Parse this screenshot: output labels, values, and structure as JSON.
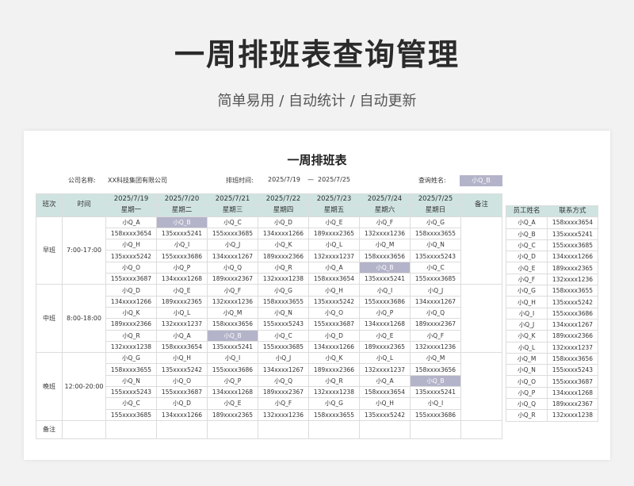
{
  "hero": {
    "title": "一周排班表查询管理",
    "subtitle": "简单易用  /  自动统计  /  自动更新"
  },
  "sheet": {
    "title": "一周排班表",
    "company_label": "公司名称:",
    "company_value": "XX科技集团有限公司",
    "period_label": "排班时间:",
    "period_start": "2025/7/19",
    "period_sep": "—",
    "period_end": "2025/7/25",
    "query_label": "查询姓名:",
    "query_value": "小Q_B"
  },
  "schedule": {
    "col_shift": "班次",
    "col_time": "时间",
    "col_remark": "备注",
    "days": [
      {
        "date": "2025/7/19",
        "weekday": "星期一"
      },
      {
        "date": "2025/7/20",
        "weekday": "星期二"
      },
      {
        "date": "2025/7/21",
        "weekday": "星期三"
      },
      {
        "date": "2025/7/22",
        "weekday": "星期四"
      },
      {
        "date": "2025/7/23",
        "weekday": "星期五"
      },
      {
        "date": "2025/7/24",
        "weekday": "星期六"
      },
      {
        "date": "2025/7/25",
        "weekday": "星期日"
      }
    ],
    "shifts": [
      {
        "name": "早班",
        "time": "7:00-17:00",
        "rows": [
          [
            [
              "小Q_A",
              "158xxxx3654"
            ],
            [
              "小Q_B",
              "135xxxx5241"
            ],
            [
              "小Q_C",
              "155xxxx3685"
            ],
            [
              "小Q_D",
              "134xxxx1266"
            ],
            [
              "小Q_E",
              "189xxxx2365"
            ],
            [
              "小Q_F",
              "132xxxx1236"
            ],
            [
              "小Q_G",
              "158xxxx3655"
            ]
          ],
          [
            [
              "小Q_H",
              "135xxxx5242"
            ],
            [
              "小Q_I",
              "155xxxx3686"
            ],
            [
              "小Q_J",
              "134xxxx1267"
            ],
            [
              "小Q_K",
              "189xxxx2366"
            ],
            [
              "小Q_L",
              "132xxxx1237"
            ],
            [
              "小Q_M",
              "158xxxx3656"
            ],
            [
              "小Q_N",
              "135xxxx5243"
            ]
          ],
          [
            [
              "小Q_O",
              "155xxxx3687"
            ],
            [
              "小Q_P",
              "134xxxx1268"
            ],
            [
              "小Q_Q",
              "189xxxx2367"
            ],
            [
              "小Q_R",
              "132xxxx1238"
            ],
            [
              "小Q_A",
              "158xxxx3654"
            ],
            [
              "小Q_B",
              "135xxxx5241"
            ],
            [
              "小Q_C",
              "155xxxx3685"
            ]
          ]
        ]
      },
      {
        "name": "中班",
        "time": "8:00-18:00",
        "rows": [
          [
            [
              "小Q_D",
              "134xxxx1266"
            ],
            [
              "小Q_E",
              "189xxxx2365"
            ],
            [
              "小Q_F",
              "132xxxx1236"
            ],
            [
              "小Q_G",
              "158xxxx3655"
            ],
            [
              "小Q_H",
              "135xxxx5242"
            ],
            [
              "小Q_I",
              "155xxxx3686"
            ],
            [
              "小Q_J",
              "134xxxx1267"
            ]
          ],
          [
            [
              "小Q_K",
              "189xxxx2366"
            ],
            [
              "小Q_L",
              "132xxxx1237"
            ],
            [
              "小Q_M",
              "158xxxx3656"
            ],
            [
              "小Q_N",
              "155xxxx5243"
            ],
            [
              "小Q_O",
              "155xxxx3687"
            ],
            [
              "小Q_P",
              "134xxxx1268"
            ],
            [
              "小Q_Q",
              "189xxxx2367"
            ]
          ],
          [
            [
              "小Q_R",
              "132xxxx1238"
            ],
            [
              "小Q_A",
              "158xxxx3654"
            ],
            [
              "小Q_B",
              "135xxxx5241"
            ],
            [
              "小Q_C",
              "155xxxx3685"
            ],
            [
              "小Q_D",
              "134xxxx1266"
            ],
            [
              "小Q_E",
              "189xxxx2365"
            ],
            [
              "小Q_F",
              "132xxxx1236"
            ]
          ]
        ]
      },
      {
        "name": "晚班",
        "time": "12:00-20:00",
        "rows": [
          [
            [
              "小Q_G",
              "158xxxx3655"
            ],
            [
              "小Q_H",
              "135xxxx5242"
            ],
            [
              "小Q_I",
              "155xxxx3686"
            ],
            [
              "小Q_J",
              "134xxxx1267"
            ],
            [
              "小Q_K",
              "189xxxx2366"
            ],
            [
              "小Q_L",
              "132xxxx1237"
            ],
            [
              "小Q_M",
              "158xxxx3656"
            ]
          ],
          [
            [
              "小Q_N",
              "155xxxx5243"
            ],
            [
              "小Q_O",
              "155xxxx3687"
            ],
            [
              "小Q_P",
              "134xxxx1268"
            ],
            [
              "小Q_Q",
              "189xxxx2367"
            ],
            [
              "小Q_R",
              "132xxxx1238"
            ],
            [
              "小Q_A",
              "158xxxx3654"
            ],
            [
              "小Q_B",
              "135xxxx5241"
            ]
          ],
          [
            [
              "小Q_C",
              "155xxxx3685"
            ],
            [
              "小Q_D",
              "134xxxx1266"
            ],
            [
              "小Q_E",
              "189xxxx2365"
            ],
            [
              "小Q_F",
              "132xxxx1236"
            ],
            [
              "小Q_G",
              "158xxxx3655"
            ],
            [
              "小Q_H",
              "135xxxx5242"
            ],
            [
              "小Q_I",
              "155xxxx3686"
            ]
          ]
        ]
      }
    ],
    "remark_row_label": "备注"
  },
  "employees": {
    "col_name": "员工姓名",
    "col_contact": "联系方式",
    "rows": [
      [
        "小Q_A",
        "158xxxx3654"
      ],
      [
        "小Q_B",
        "135xxxx5241"
      ],
      [
        "小Q_C",
        "155xxxx3685"
      ],
      [
        "小Q_D",
        "134xxxx1266"
      ],
      [
        "小Q_E",
        "189xxxx2365"
      ],
      [
        "小Q_F",
        "132xxxx1236"
      ],
      [
        "小Q_G",
        "158xxxx3655"
      ],
      [
        "小Q_H",
        "135xxxx5242"
      ],
      [
        "小Q_I",
        "155xxxx3686"
      ],
      [
        "小Q_J",
        "134xxxx1267"
      ],
      [
        "小Q_K",
        "189xxxx2366"
      ],
      [
        "小Q_L",
        "132xxxx1237"
      ],
      [
        "小Q_M",
        "158xxxx3656"
      ],
      [
        "小Q_N",
        "155xxxx5243"
      ],
      [
        "小Q_O",
        "155xxxx3687"
      ],
      [
        "小Q_P",
        "134xxxx1268"
      ],
      [
        "小Q_Q",
        "189xxxx2367"
      ],
      [
        "小Q_R",
        "132xxxx1238"
      ]
    ]
  },
  "colors": {
    "header_bg": "#cfe4e1",
    "highlight_bg": "#b3b3c9"
  }
}
